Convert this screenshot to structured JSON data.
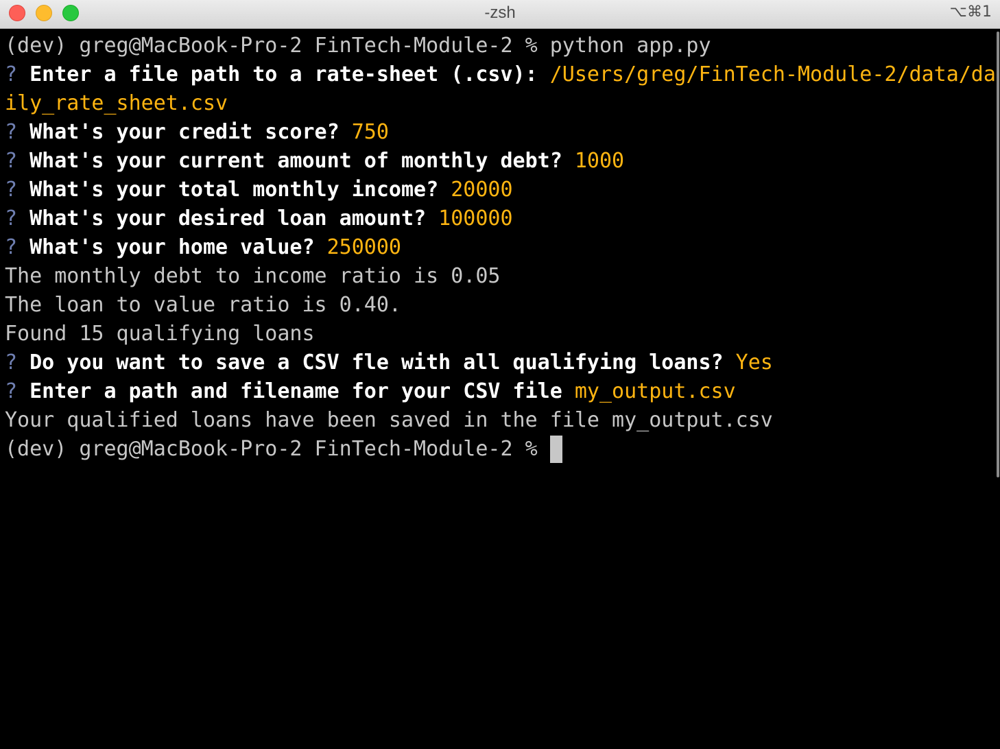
{
  "window": {
    "title": "-zsh",
    "shortcut": "⌥⌘1"
  },
  "terminal": {
    "prompt": "(dev) greg@MacBook-Pro-2 FinTech-Module-2 % ",
    "command": "python app.py",
    "question_mark": "?",
    "q_file_path": "Enter a file path to a rate-sheet (.csv): ",
    "a_file_path_1": "/Users/greg/FinTech-Module-2/data/da",
    "a_file_path_2": "ily_rate_sheet.csv",
    "q_credit": "What's your credit score? ",
    "a_credit": "750",
    "q_debt": "What's your current amount of monthly debt? ",
    "a_debt": "1000",
    "q_income": "What's your total monthly income? ",
    "a_income": "20000",
    "q_loan": "What's your desired loan amount? ",
    "a_loan": "100000",
    "q_home": "What's your home value? ",
    "a_home": "250000",
    "out_dti": "The monthly debt to income ratio is 0.05",
    "out_ltv": "The loan to value ratio is 0.40.",
    "out_found": "Found 15 qualifying loans",
    "q_save": "Do you want to save a CSV fle with all qualifying loans? ",
    "a_save": "Yes",
    "q_path": "Enter a path and filename for your CSV file ",
    "a_path": "my_output.csv",
    "out_saved": "Your qualified loans have been saved in the file my_output.csv",
    "prompt_final": "(dev) greg@MacBook-Pro-2 FinTech-Module-2 % "
  },
  "colors": {
    "background": "#000000",
    "plain_text": "#c7c7c7",
    "question_mark": "#6f7fb1",
    "question_text": "#ffffff",
    "answer_text": "#ffb511"
  }
}
